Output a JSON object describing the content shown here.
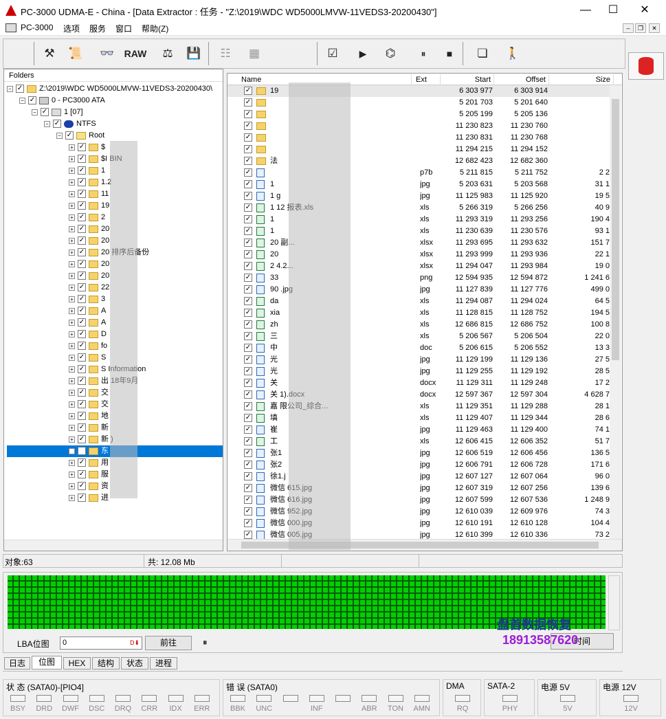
{
  "window": {
    "title": "PC-3000 UDMA-E - China - [Data Extractor : 任务 - \"Z:\\2019\\WDC WD5000LMVW-11VEDS3-20200430\"]",
    "minimize": "—",
    "maximize": "☐",
    "close": "✕"
  },
  "menu": {
    "items": [
      "PC-3000",
      "选项",
      "服务",
      "窗口",
      "帮助(Z)"
    ]
  },
  "toolbar": {
    "raw_label": "RAW",
    "play": "▶",
    "pause": "⏸",
    "stop": "■"
  },
  "folders": {
    "header": "Folders",
    "root_path": "Z:\\2019\\WDC WD5000LMVW-11VEDS3-20200430\\",
    "drive": "0 - PC3000 ATA",
    "partition": "1 [07]",
    "fs": "NTFS",
    "root": "Root",
    "items": [
      "$",
      "$I BIN",
      "1",
      "1.2",
      "11",
      "19",
      "2",
      "20",
      "20",
      "20 排序后备份",
      "20",
      "20",
      "22",
      "3",
      "A",
      "A",
      "D",
      "fo",
      "S",
      "S Information",
      "出 18年9月",
      "交",
      "交",
      "地",
      "新",
      "新 )",
      "东",
      "用",
      "服",
      "资",
      "进"
    ]
  },
  "files": {
    "columns": {
      "name": "Name",
      "ext": "Ext",
      "start": "Start",
      "offset": "Offset",
      "size": "Size"
    },
    "rows": [
      {
        "name": "19",
        "ext": "",
        "start": "6 303 977",
        "offset": "6 303 914",
        "size": "",
        "icon": "folder"
      },
      {
        "name": "",
        "ext": "",
        "start": "5 201 703",
        "offset": "5 201 640",
        "size": "",
        "icon": "folder"
      },
      {
        "name": "",
        "ext": "",
        "start": "5 205 199",
        "offset": "5 205 136",
        "size": "",
        "icon": "folder"
      },
      {
        "name": "",
        "ext": "",
        "start": "11 230 823",
        "offset": "11 230 760",
        "size": "",
        "icon": "folder"
      },
      {
        "name": "",
        "ext": "",
        "start": "11 230 831",
        "offset": "11 230 768",
        "size": "",
        "icon": "folder"
      },
      {
        "name": "",
        "ext": "",
        "start": "11 294 215",
        "offset": "11 294 152",
        "size": "",
        "icon": "folder"
      },
      {
        "name": "法",
        "ext": "",
        "start": "12 682 423",
        "offset": "12 682 360",
        "size": "",
        "icon": "folder"
      },
      {
        "name": "",
        "ext": "p7b",
        "start": "5 211 815",
        "offset": "5 211 752",
        "size": "2 2",
        "icon": "doc"
      },
      {
        "name": "1",
        "ext": "jpg",
        "start": "5 203 631",
        "offset": "5 203 568",
        "size": "31 1",
        "icon": "img"
      },
      {
        "name": "1 g",
        "ext": "jpg",
        "start": "11 125 983",
        "offset": "11 125 920",
        "size": "19 5",
        "icon": "img"
      },
      {
        "name": "1 12 报表.xls",
        "ext": "xls",
        "start": "5 266 319",
        "offset": "5 266 256",
        "size": "40 9",
        "icon": "xls"
      },
      {
        "name": "1",
        "ext": "xls",
        "start": "11 293 319",
        "offset": "11 293 256",
        "size": "190 4",
        "icon": "xls"
      },
      {
        "name": "1",
        "ext": "xls",
        "start": "11 230 639",
        "offset": "11 230 576",
        "size": "93 1",
        "icon": "xls"
      },
      {
        "name": "20 副...",
        "ext": "xlsx",
        "start": "11 293 695",
        "offset": "11 293 632",
        "size": "151 7",
        "icon": "xls"
      },
      {
        "name": "20",
        "ext": "xlsx",
        "start": "11 293 999",
        "offset": "11 293 936",
        "size": "22 1",
        "icon": "xls"
      },
      {
        "name": "2 4.2...",
        "ext": "xlsx",
        "start": "11 294 047",
        "offset": "11 293 984",
        "size": "19 0",
        "icon": "xls"
      },
      {
        "name": "33",
        "ext": "png",
        "start": "12 594 935",
        "offset": "12 594 872",
        "size": "1 241 6",
        "icon": "img"
      },
      {
        "name": "90 .jpg",
        "ext": "jpg",
        "start": "11 127 839",
        "offset": "11 127 776",
        "size": "499 0",
        "icon": "img"
      },
      {
        "name": "da",
        "ext": "xls",
        "start": "11 294 087",
        "offset": "11 294 024",
        "size": "64 5",
        "icon": "xls"
      },
      {
        "name": "xia",
        "ext": "xls",
        "start": "11 128 815",
        "offset": "11 128 752",
        "size": "194 5",
        "icon": "xls"
      },
      {
        "name": "zh",
        "ext": "xls",
        "start": "12 686 815",
        "offset": "12 686 752",
        "size": "100 8",
        "icon": "xls"
      },
      {
        "name": "三",
        "ext": "xls",
        "start": "5 206 567",
        "offset": "5 206 504",
        "size": "22 0",
        "icon": "xls"
      },
      {
        "name": "中",
        "ext": "doc",
        "start": "5 206 615",
        "offset": "5 206 552",
        "size": "13 3",
        "icon": "doc"
      },
      {
        "name": "光",
        "ext": "jpg",
        "start": "11 129 199",
        "offset": "11 129 136",
        "size": "27 5",
        "icon": "img"
      },
      {
        "name": "光",
        "ext": "jpg",
        "start": "11 129 255",
        "offset": "11 129 192",
        "size": "28 5",
        "icon": "img"
      },
      {
        "name": "关",
        "ext": "docx",
        "start": "11 129 311",
        "offset": "11 129 248",
        "size": "17 2",
        "icon": "doc"
      },
      {
        "name": "关 1).docx",
        "ext": "docx",
        "start": "12 597 367",
        "offset": "12 597 304",
        "size": "4 628 7",
        "icon": "doc"
      },
      {
        "name": "嘉 限公司_综合...",
        "ext": "xls",
        "start": "11 129 351",
        "offset": "11 129 288",
        "size": "28 1",
        "icon": "xls"
      },
      {
        "name": "填",
        "ext": "xls",
        "start": "11 129 407",
        "offset": "11 129 344",
        "size": "28 6",
        "icon": "xls"
      },
      {
        "name": "崔",
        "ext": "jpg",
        "start": "11 129 463",
        "offset": "11 129 400",
        "size": "74 1",
        "icon": "img"
      },
      {
        "name": "工",
        "ext": "xls",
        "start": "12 606 415",
        "offset": "12 606 352",
        "size": "51 7",
        "icon": "xls"
      },
      {
        "name": "张1",
        "ext": "jpg",
        "start": "12 606 519",
        "offset": "12 606 456",
        "size": "136 5",
        "icon": "img"
      },
      {
        "name": "张2",
        "ext": "jpg",
        "start": "12 606 791",
        "offset": "12 606 728",
        "size": "171 6",
        "icon": "img"
      },
      {
        "name": "徐1.j",
        "ext": "jpg",
        "start": "12 607 127",
        "offset": "12 607 064",
        "size": "96 0",
        "icon": "img"
      },
      {
        "name": "微信 615.jpg",
        "ext": "jpg",
        "start": "12 607 319",
        "offset": "12 607 256",
        "size": "139 6",
        "icon": "img"
      },
      {
        "name": "微信 616.jpg",
        "ext": "jpg",
        "start": "12 607 599",
        "offset": "12 607 536",
        "size": "1 248 9",
        "icon": "img"
      },
      {
        "name": "微信 952.jpg",
        "ext": "jpg",
        "start": "12 610 039",
        "offset": "12 609 976",
        "size": "74 3",
        "icon": "img"
      },
      {
        "name": "微信 000.jpg",
        "ext": "jpg",
        "start": "12 610 191",
        "offset": "12 610 128",
        "size": "104 4",
        "icon": "img"
      },
      {
        "name": "微信 005.jpg",
        "ext": "jpg",
        "start": "12 610 399",
        "offset": "12 610 336",
        "size": "73 2",
        "icon": "img"
      }
    ]
  },
  "status": {
    "objects": "对象:63",
    "total": "共: 12.08 Mb"
  },
  "bitmap": {
    "lba_label": "LBA位图",
    "lba_value": "0",
    "go_button": "前往",
    "pause": "⏸",
    "right_button": "时间",
    "watermark1": "盘首数据恢复",
    "watermark2": "18913587620"
  },
  "tabs": [
    "日志",
    "位图",
    "HEX",
    "结构",
    "状态",
    "进程"
  ],
  "indicators": {
    "groups": [
      {
        "title": "状 态 (SATA0)-[PIO4]",
        "leds": [
          "BSY",
          "DRD",
          "DWF",
          "DSC",
          "DRQ",
          "CRR",
          "IDX",
          "ERR"
        ]
      },
      {
        "title": "错 误 (SATA0)",
        "leds": [
          "BBK",
          "UNC",
          "",
          "INF",
          "",
          "ABR",
          "TON",
          "AMN"
        ]
      },
      {
        "title": "DMA",
        "leds": [
          "RQ"
        ]
      },
      {
        "title": "SATA-2",
        "leds": [
          "PHY"
        ]
      },
      {
        "title": "电源 5V",
        "leds": [
          "5V"
        ]
      },
      {
        "title": "电源 12V",
        "leds": [
          "12V"
        ]
      }
    ]
  },
  "colors": {
    "selection": "#0078d7",
    "bitmap_green": "#00d000",
    "watermark1": "#1a3a8c",
    "watermark2": "#9b1cd6"
  }
}
